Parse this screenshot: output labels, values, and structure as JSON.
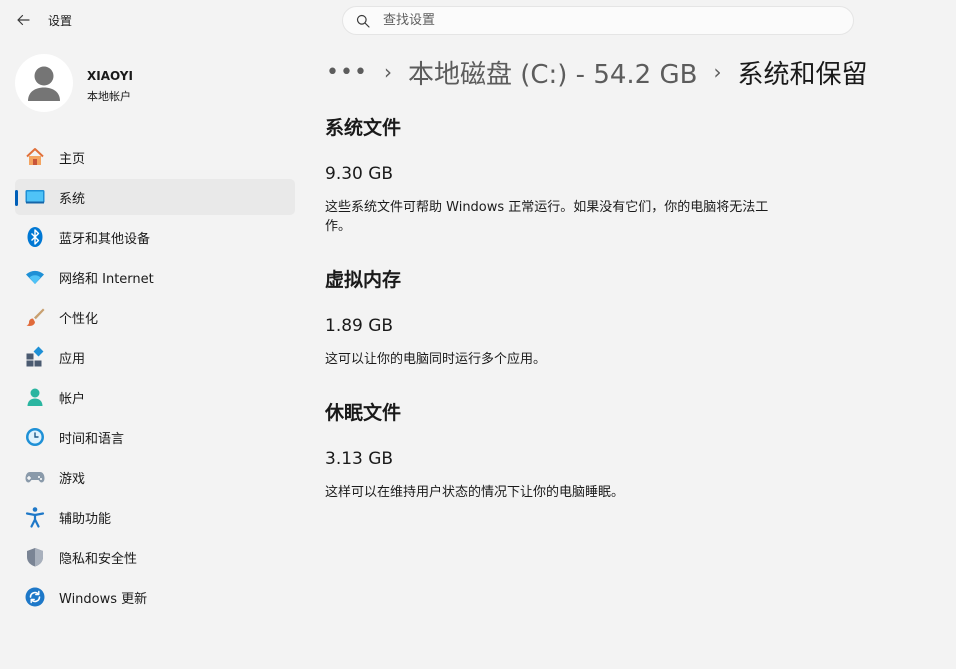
{
  "window": {
    "title": "设置"
  },
  "search": {
    "placeholder": "查找设置",
    "value": ""
  },
  "profile": {
    "name": "XIAOYI",
    "account_type": "本地帐户"
  },
  "sidebar": {
    "items": [
      {
        "label": "主页",
        "icon": "home-icon",
        "active": false
      },
      {
        "label": "系统",
        "icon": "monitor-icon",
        "active": true
      },
      {
        "label": "蓝牙和其他设备",
        "icon": "bluetooth-icon",
        "active": false
      },
      {
        "label": "网络和 Internet",
        "icon": "wifi-icon",
        "active": false
      },
      {
        "label": "个性化",
        "icon": "paintbrush-icon",
        "active": false
      },
      {
        "label": "应用",
        "icon": "apps-icon",
        "active": false
      },
      {
        "label": "帐户",
        "icon": "person-icon",
        "active": false
      },
      {
        "label": "时间和语言",
        "icon": "clock-globe-icon",
        "active": false
      },
      {
        "label": "游戏",
        "icon": "gamepad-icon",
        "active": false
      },
      {
        "label": "辅助功能",
        "icon": "accessibility-icon",
        "active": false
      },
      {
        "label": "隐私和安全性",
        "icon": "shield-icon",
        "active": false
      },
      {
        "label": "Windows 更新",
        "icon": "update-icon",
        "active": false
      }
    ]
  },
  "breadcrumb": {
    "more": "•••",
    "parent": "本地磁盘 (C:) - 54.2 GB",
    "current": "系统和保留"
  },
  "sections": [
    {
      "title": "系统文件",
      "value": "9.30 GB",
      "description": "这些系统文件可帮助 Windows 正常运行。如果没有它们，你的电脑将无法工作。"
    },
    {
      "title": "虚拟内存",
      "value": "1.89 GB",
      "description": "这可以让你的电脑同时运行多个应用。"
    },
    {
      "title": "休眠文件",
      "value": "3.13 GB",
      "description": "这样可以在维持用户状态的情况下让你的电脑睡眠。"
    }
  ],
  "colors": {
    "accent": "#005fb8",
    "background": "#f3f3f3",
    "selected": "#e9e9e9"
  }
}
